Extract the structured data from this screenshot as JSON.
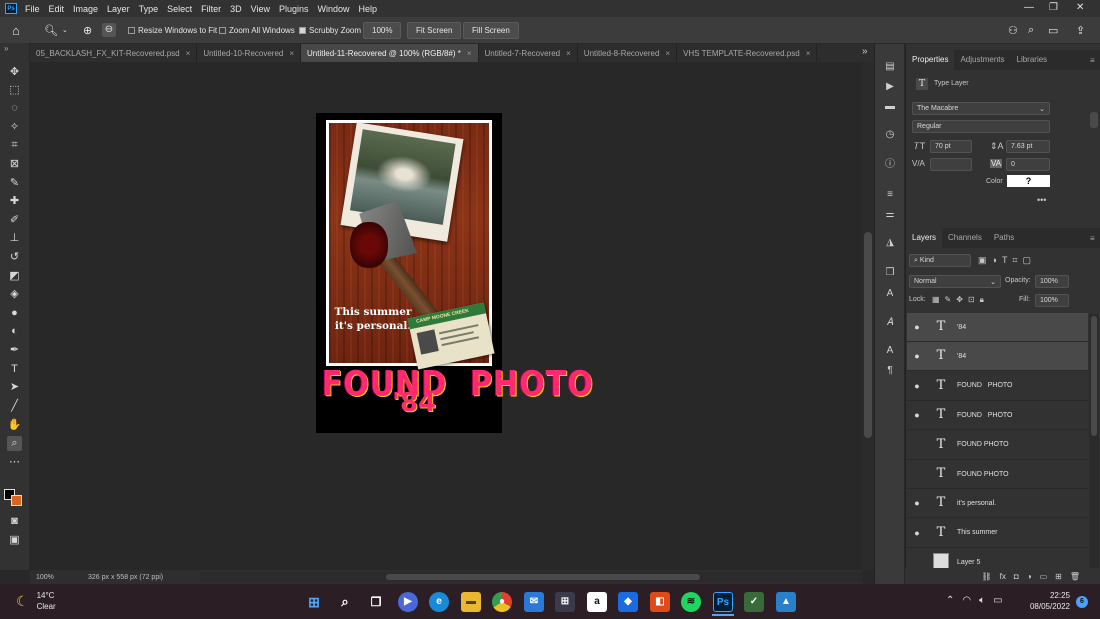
{
  "app": {
    "logo": "Ps"
  },
  "menu": [
    "File",
    "Edit",
    "Image",
    "Layer",
    "Type",
    "Select",
    "Filter",
    "3D",
    "View",
    "Plugins",
    "Window",
    "Help"
  ],
  "options": {
    "resize_windows": "Resize Windows to Fit",
    "zoom_all": "Zoom All Windows",
    "scrubby_zoom": "Scrubby Zoom",
    "zoom_value": "100%",
    "fit_screen": "Fit Screen",
    "fill_screen": "Fill Screen"
  },
  "tabs": [
    {
      "label": "05_BACKLASH_FX_KIT-Recovered.psd",
      "active": false
    },
    {
      "label": "Untitled-10-Recovered",
      "active": false
    },
    {
      "label": "Untitled-11-Recovered @ 100% (RGB/8#) *",
      "active": true
    },
    {
      "label": "Untitled-7-Recovered",
      "active": false
    },
    {
      "label": "Untitled-8-Recovered",
      "active": false
    },
    {
      "label": "VHS TEMPLATE-Recovered.psd",
      "active": false
    }
  ],
  "artwork": {
    "tagline_1": "This summer",
    "tagline_2": "it's personal.",
    "title": "FOUND  PHOTO",
    "year": "'84",
    "id_card_text": "CAMP MOONE CREEK"
  },
  "status": {
    "zoom": "100%",
    "doc_size": "326 px x 558 px (72 ppi)"
  },
  "properties": {
    "tabs": [
      "Properties",
      "Adjustments",
      "Libraries"
    ],
    "layer_kind": "Type Layer",
    "font_family": "The Macabre",
    "font_style": "Regular",
    "font_size": "70 pt",
    "leading": "7.63 pt",
    "tracking": "0",
    "color_label": "Color",
    "color_value": "?",
    "more": "•••"
  },
  "layers_panel": {
    "tabs": [
      "Layers",
      "Channels",
      "Paths"
    ],
    "filter": "Kind",
    "blend_mode": "Normal",
    "opacity_label": "Opacity:",
    "opacity": "100%",
    "lock_label": "Lock:",
    "fill_label": "Fill:",
    "fill": "100%",
    "layers": [
      {
        "name": "'84",
        "visible": true,
        "selected": true,
        "type": "T"
      },
      {
        "name": "'84",
        "visible": true,
        "selected": true,
        "type": "T"
      },
      {
        "name": "FOUND   PHOTO",
        "visible": true,
        "selected": false,
        "type": "T"
      },
      {
        "name": "FOUND   PHOTO",
        "visible": true,
        "selected": false,
        "type": "T"
      },
      {
        "name": "FOUND PHOTO",
        "visible": false,
        "selected": false,
        "type": "T"
      },
      {
        "name": "FOUND PHOTO",
        "visible": false,
        "selected": false,
        "type": "T"
      },
      {
        "name": "it's personal.",
        "visible": true,
        "selected": false,
        "type": "T"
      },
      {
        "name": "This summer",
        "visible": true,
        "selected": false,
        "type": "T"
      },
      {
        "name": "Layer 5",
        "visible": false,
        "selected": false,
        "type": "img"
      }
    ]
  },
  "taskbar": {
    "temp": "14°C",
    "weather": "Clear",
    "time": "22:25",
    "date": "08/05/2022",
    "notifications": "6",
    "apps": [
      "windows-start",
      "search",
      "task-view",
      "zoom",
      "edge",
      "file-explorer",
      "chrome",
      "mail",
      "store",
      "amazon",
      "dropbox",
      "office",
      "spotify",
      "photoshop",
      "checkmark-app",
      "photos"
    ],
    "ps_label": "Ps",
    "amazon_label": "a"
  },
  "colors": {
    "accent": "#31a8ff",
    "title_pink": "#ff2a6e",
    "title_yellow": "#ffcc00",
    "wood": "#7a2a14"
  }
}
